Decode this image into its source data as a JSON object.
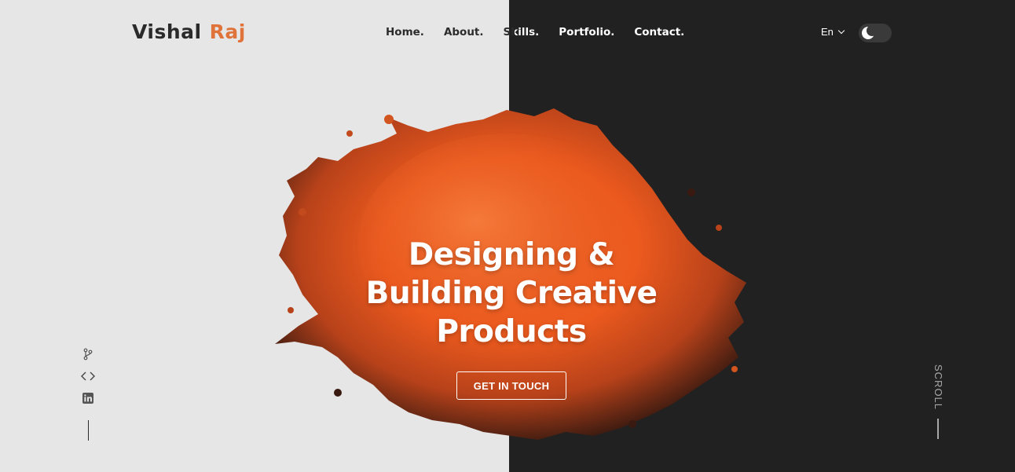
{
  "header": {
    "logo_first": "Vishal",
    "logo_last": "Raj",
    "nav": [
      "Home.",
      "About.",
      "Skills.",
      "Portfolio.",
      "Contact."
    ],
    "language": "En",
    "theme_toggle": "dark-mode"
  },
  "socials": {
    "icons": [
      "git-branch-icon",
      "code-icon",
      "linkedin-icon"
    ]
  },
  "hero": {
    "title_line1": "Designing &",
    "title_line2": "Building Creative",
    "title_line3": "Products",
    "cta_label": "GET IN TOUCH"
  },
  "scroll": {
    "label": "SCROLL"
  },
  "colors": {
    "left_bg": "#e6e6e6",
    "right_bg": "#212121",
    "accent": "#e0733a",
    "splash": "#f05a1e"
  }
}
